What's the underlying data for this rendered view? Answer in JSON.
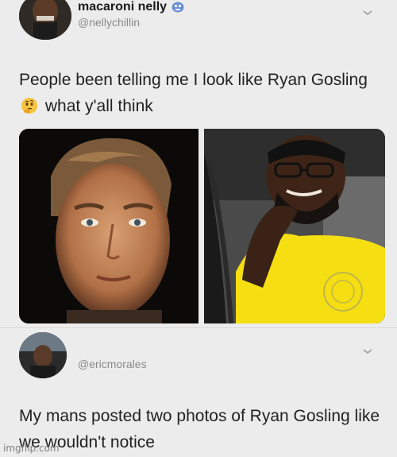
{
  "tweet": {
    "display_name": "macaroni nelly",
    "verified_icon": "face-emoji-icon",
    "handle": "@nellychillin",
    "text_part1": "People been telling me I look like Ryan Gosling",
    "emoji": "thinking-face-emoji",
    "text_part2": "what y'all think",
    "menu_icon": "chevron-down-icon"
  },
  "photos": {
    "left": "photo-ryan-gosling-portrait",
    "right": "photo-man-yellow-shirt-selfie"
  },
  "reply": {
    "handle": "@ericmorales",
    "text": "My mans posted two photos of Ryan Gosling like we wouldn't notice",
    "menu_icon": "chevron-down-icon"
  },
  "watermark": "imgflip.com"
}
